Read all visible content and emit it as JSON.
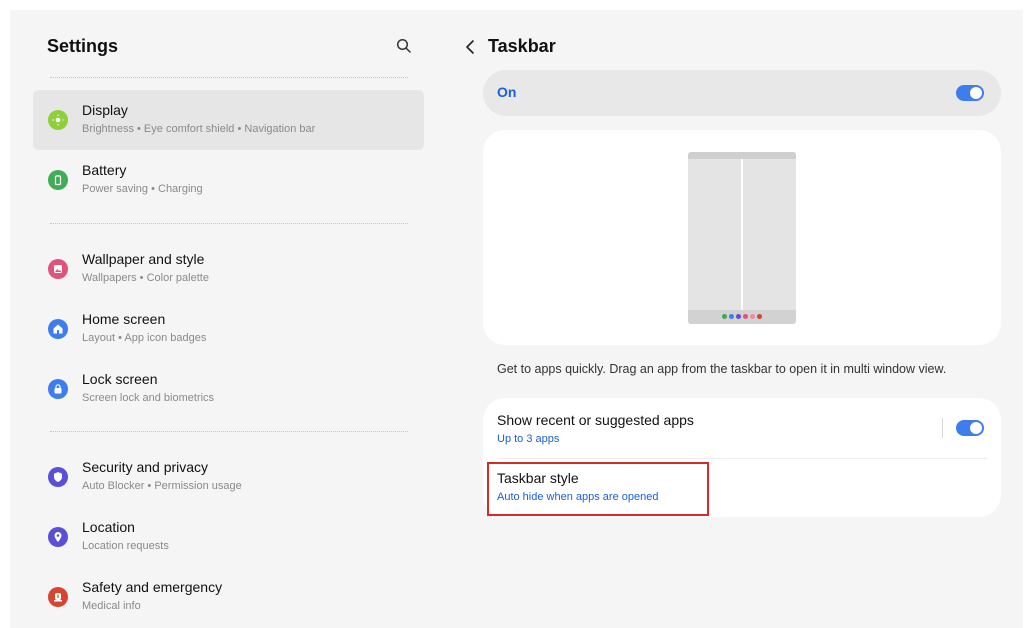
{
  "left": {
    "title": "Settings",
    "search_icon": "search-icon",
    "items": [
      {
        "title": "Display",
        "subtitle": "Brightness  •  Eye comfort shield  •  Navigation bar",
        "icon": "sun-icon",
        "color": "#8fcf3a"
      },
      {
        "title": "Battery",
        "subtitle": "Power saving  •  Charging",
        "icon": "battery-icon",
        "color": "#3fae55"
      },
      {
        "title": "Wallpaper and style",
        "subtitle": "Wallpapers  •  Color palette",
        "icon": "image-icon",
        "color": "#e2527a"
      },
      {
        "title": "Home screen",
        "subtitle": "Layout  •  App icon badges",
        "icon": "home-icon",
        "color": "#3d7ded"
      },
      {
        "title": "Lock screen",
        "subtitle": "Screen lock and biometrics",
        "icon": "lock-icon",
        "color": "#3d7ded"
      },
      {
        "title": "Security and privacy",
        "subtitle": "Auto Blocker  •  Permission usage",
        "icon": "shield-icon",
        "color": "#5a4fd6"
      },
      {
        "title": "Location",
        "subtitle": "Location requests",
        "icon": "location-pin-icon",
        "color": "#5a4fd6"
      },
      {
        "title": "Safety and emergency",
        "subtitle": "Medical info",
        "icon": "alert-icon",
        "color": "#d6452f"
      }
    ]
  },
  "right": {
    "back_icon": "chevron-left-icon",
    "title": "Taskbar",
    "on_label": "On",
    "on_toggle": true,
    "description": "Get to apps quickly. Drag an app from the taskbar to open it in multi window view.",
    "preview_dot_colors": [
      "#3ea84f",
      "#3d7ded",
      "#5a4fd6",
      "#e2527a",
      "#f08aa8",
      "#d6452f"
    ],
    "options": [
      {
        "title": "Show recent or suggested apps",
        "subtitle": "Up to 3 apps",
        "toggle": true
      },
      {
        "title": "Taskbar style",
        "subtitle": "Auto hide when apps are opened"
      }
    ]
  },
  "colors": {
    "accent": "#3d7ded",
    "link": "#1a5fd6",
    "highlight": "#d92a2a"
  }
}
